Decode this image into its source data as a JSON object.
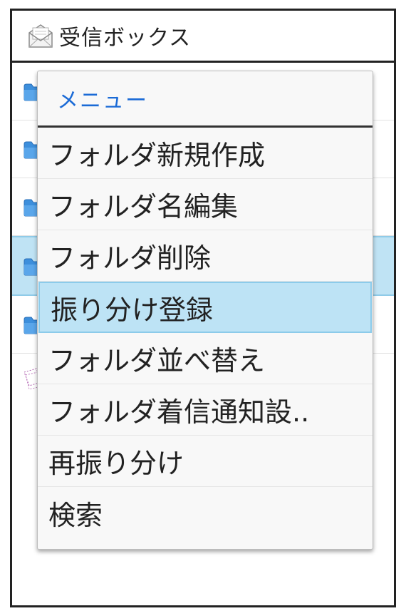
{
  "header": {
    "title": "受信ボックス",
    "icon": "envelope-open-icon"
  },
  "background_list": {
    "rows": [
      {
        "icon": "folder-icon"
      },
      {
        "icon": "folder-icon"
      },
      {
        "icon": "folder-icon"
      },
      {
        "icon": "folder-icon",
        "selected": true
      },
      {
        "icon": "folder-icon"
      },
      {
        "icon": "mail-stack-icon"
      }
    ]
  },
  "menu": {
    "title": "メニュー",
    "items": [
      {
        "label": "フォルダ新規作成"
      },
      {
        "label": "フォルダ名編集"
      },
      {
        "label": "フォルダ削除"
      },
      {
        "label": "振り分け登録",
        "highlighted": true
      },
      {
        "label": "フォルダ並べ替え"
      },
      {
        "label": "フォルダ着信通知設.."
      },
      {
        "label": "再振り分け"
      },
      {
        "label": "検索"
      }
    ]
  },
  "colors": {
    "accent": "#1a6ad6",
    "highlight": "#bde3f5",
    "frame": "#222222"
  }
}
